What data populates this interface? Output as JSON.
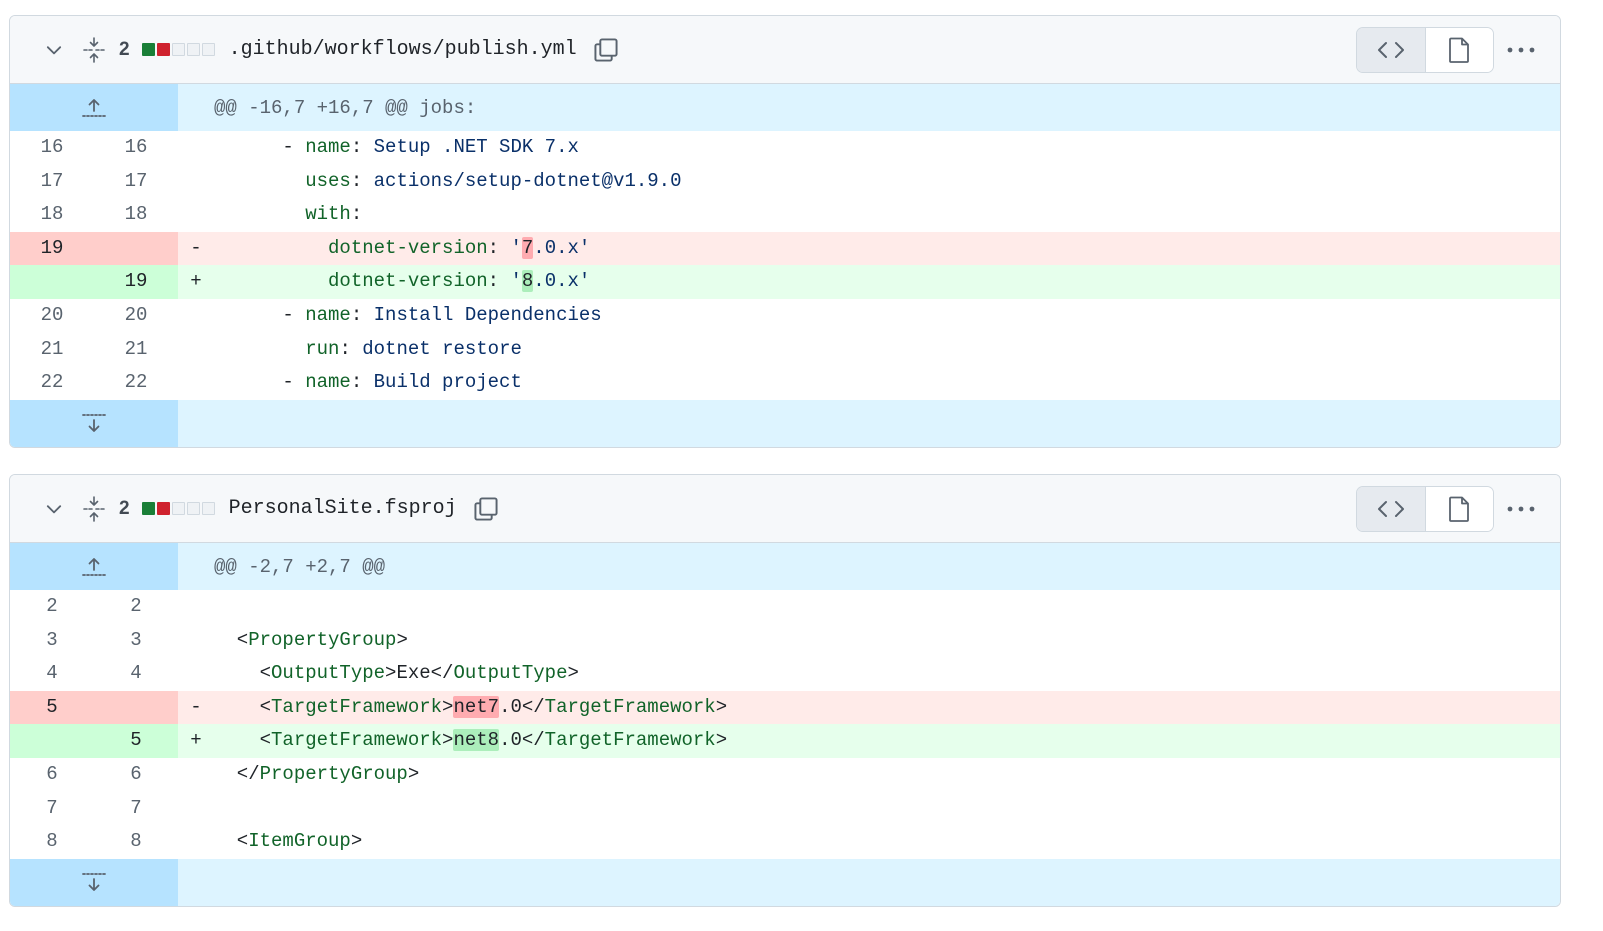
{
  "files": [
    {
      "changes": "2",
      "filename": ".github/workflows/publish.yml",
      "hunk": "@@ -16,7 +16,7 @@ jobs:",
      "lines": [
        {
          "type": "ctx",
          "old": "16",
          "new": "16",
          "marker": "",
          "segs": [
            [
              "",
              "      - "
            ],
            [
              "k",
              "name"
            ],
            [
              "",
              ": "
            ],
            [
              "s",
              "Setup .NET SDK 7.x"
            ]
          ]
        },
        {
          "type": "ctx",
          "old": "17",
          "new": "17",
          "marker": "",
          "segs": [
            [
              "",
              "        "
            ],
            [
              "k",
              "uses"
            ],
            [
              "",
              ": "
            ],
            [
              "s",
              "actions/setup-dotnet@v1.9.0"
            ]
          ]
        },
        {
          "type": "ctx",
          "old": "18",
          "new": "18",
          "marker": "",
          "segs": [
            [
              "",
              "        "
            ],
            [
              "k",
              "with"
            ],
            [
              "",
              ":"
            ]
          ]
        },
        {
          "type": "del",
          "old": "19",
          "new": "",
          "marker": "-",
          "segs": [
            [
              "",
              "          "
            ],
            [
              "k",
              "dotnet-version"
            ],
            [
              "",
              ": "
            ],
            [
              "s",
              "'"
            ],
            [
              "hl-del",
              "7"
            ],
            [
              "s",
              ".0.x'"
            ]
          ]
        },
        {
          "type": "add",
          "old": "",
          "new": "19",
          "marker": "+",
          "segs": [
            [
              "",
              "          "
            ],
            [
              "k",
              "dotnet-version"
            ],
            [
              "",
              ": "
            ],
            [
              "s",
              "'"
            ],
            [
              "hl-add",
              "8"
            ],
            [
              "s",
              ".0.x'"
            ]
          ]
        },
        {
          "type": "ctx",
          "old": "20",
          "new": "20",
          "marker": "",
          "segs": [
            [
              "",
              "      - "
            ],
            [
              "k",
              "name"
            ],
            [
              "",
              ": "
            ],
            [
              "s",
              "Install Dependencies"
            ]
          ]
        },
        {
          "type": "ctx",
          "old": "21",
          "new": "21",
          "marker": "",
          "segs": [
            [
              "",
              "        "
            ],
            [
              "k",
              "run"
            ],
            [
              "",
              ": "
            ],
            [
              "s",
              "dotnet restore"
            ]
          ]
        },
        {
          "type": "ctx",
          "old": "22",
          "new": "22",
          "marker": "",
          "segs": [
            [
              "",
              "      - "
            ],
            [
              "k",
              "name"
            ],
            [
              "",
              ": "
            ],
            [
              "s",
              "Build project"
            ]
          ]
        }
      ]
    },
    {
      "changes": "2",
      "filename": "PersonalSite.fsproj",
      "hunk": "@@ -2,7 +2,7 @@",
      "lines": [
        {
          "type": "ctx",
          "old": "2",
          "new": "2",
          "marker": "",
          "segs": [
            [
              "",
              ""
            ]
          ]
        },
        {
          "type": "ctx",
          "old": "3",
          "new": "3",
          "marker": "",
          "segs": [
            [
              "",
              "  <"
            ],
            [
              "t",
              "PropertyGroup"
            ],
            [
              "",
              ">"
            ]
          ]
        },
        {
          "type": "ctx",
          "old": "4",
          "new": "4",
          "marker": "",
          "segs": [
            [
              "",
              "    <"
            ],
            [
              "t",
              "OutputType"
            ],
            [
              "",
              ">Exe</"
            ],
            [
              "t",
              "OutputType"
            ],
            [
              "",
              ">"
            ]
          ]
        },
        {
          "type": "del",
          "old": "5",
          "new": "",
          "marker": "-",
          "segs": [
            [
              "",
              "    <"
            ],
            [
              "t",
              "TargetFramework"
            ],
            [
              "",
              ">"
            ],
            [
              "hl-del",
              "net7"
            ],
            [
              "",
              ".0</"
            ],
            [
              "t",
              "TargetFramework"
            ],
            [
              "",
              ">"
            ]
          ]
        },
        {
          "type": "add",
          "old": "",
          "new": "5",
          "marker": "+",
          "segs": [
            [
              "",
              "    <"
            ],
            [
              "t",
              "TargetFramework"
            ],
            [
              "",
              ">"
            ],
            [
              "hl-add",
              "net8"
            ],
            [
              "",
              ".0</"
            ],
            [
              "t",
              "TargetFramework"
            ],
            [
              "",
              ">"
            ]
          ]
        },
        {
          "type": "ctx",
          "old": "6",
          "new": "6",
          "marker": "",
          "segs": [
            [
              "",
              "  </"
            ],
            [
              "t",
              "PropertyGroup"
            ],
            [
              "",
              ">"
            ]
          ]
        },
        {
          "type": "ctx",
          "old": "7",
          "new": "7",
          "marker": "",
          "segs": [
            [
              "",
              ""
            ]
          ]
        },
        {
          "type": "ctx",
          "old": "8",
          "new": "8",
          "marker": "",
          "segs": [
            [
              "",
              "  <"
            ],
            [
              "t",
              "ItemGroup"
            ],
            [
              "",
              ">"
            ]
          ]
        }
      ]
    }
  ],
  "colors": {
    "add_block": "#1a7f37",
    "del_block": "#cf222e",
    "neutral_block": "#eff2f5"
  },
  "icons": {
    "collapse": "chevron-down-icon",
    "expand_all": "fold-vertical-icon",
    "copy": "copy-icon",
    "code_view": "code-icon",
    "file_view": "file-icon",
    "more": "kebab-horizontal-icon",
    "expand_up": "fold-up-icon",
    "expand_down": "fold-down-icon"
  }
}
